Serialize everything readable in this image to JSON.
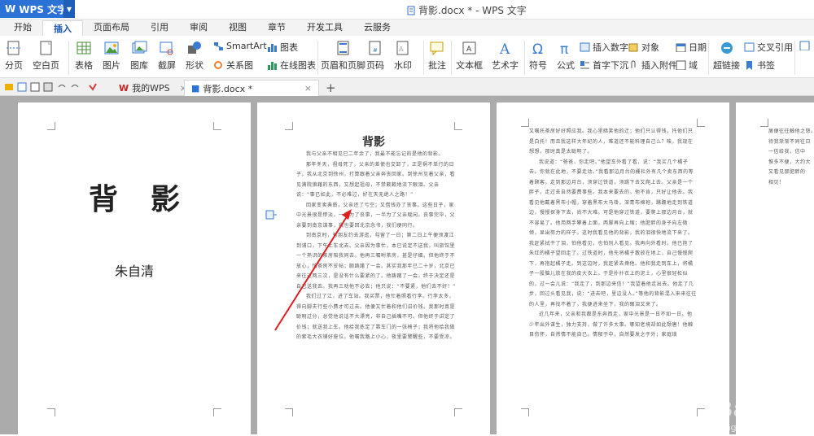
{
  "app": {
    "name": "WPS 文字",
    "window_title": "背影.docx * - WPS 文字"
  },
  "menus": [
    "开始",
    "插入",
    "页面布局",
    "引用",
    "审阅",
    "视图",
    "章节",
    "开发工具",
    "云服务"
  ],
  "active_menu": "插入",
  "ribbon": {
    "page_break": "分页",
    "blank_page": "空白页",
    "table": "表格",
    "picture": "图片",
    "gallery": "图库",
    "screenshot": "截屏",
    "shapes": "形状",
    "smartart": "SmartArt",
    "chart": "图表",
    "relation_chart": "关系图",
    "online_chart": "在线图表",
    "header_footer": "页眉和页脚",
    "page_number": "页码",
    "watermark": "水印",
    "comment": "批注",
    "textbox": "文本框",
    "wordart": "艺术字",
    "symbol": "符号",
    "formula": "公式",
    "insert_number": "插入数字",
    "object": "对象",
    "date": "日期",
    "dropcap": "首字下沉",
    "attachment": "插入附件",
    "field": "域",
    "hyperlink": "超链接",
    "crossref": "交叉引用",
    "bookmark": "书签"
  },
  "tabs": {
    "home": "我的WPS",
    "doc": "背影.docx *"
  },
  "cover": {
    "title": "背影",
    "author": "朱自清"
  },
  "page2": {
    "title": "背影",
    "paragraphs": [
      "我与父亲不相见已二年余了，我最不能忘记的是他的背影。",
      "那年冬天，祖母死了，父亲的差使也交卸了，正是祸不单行的日子。我从北京到徐州，打算跟着父亲奔丧回家。到徐州见着父亲，看见满院狼藉的东西，又想起祖母，不禁簌簌地流下眼泪。父亲说：“事已如此，不必难过，好在天无绝人之路！”",
      "回家变卖典质，父亲还了亏空；又借钱办了丧事。这些日子，家中光景很是惨淡，一半为了丧事，一半为了父亲赋闲。丧事完毕，父亲要到南京谋事，我也要回北京念书，我们便同行。",
      "到南京时，有朋友约去游逛，勾留了一日；第二日上午便须渡江到浦口，下午上车北去。父亲因为事忙，本已说定不送我，叫旅馆里一个熟识的茶房陪我同去。他再三嘱咐茶房，甚是仔细。但他终于不放心，怕茶房不妥帖；颇踌躇了一会。其实我那年已二十岁，北京已来往过两三次，是没有什么要紧的了。他踌躇了一会，终于决定还是自己送我去。我再三劝他不必去；他只说：“不要紧，他们去不好！”",
      "我们过了江，进了车站。我买票，他忙着照看行李。行李太多，得向脚夫行些小费才可过去。他便又忙着和他们讲价钱。我那时真是聪明过分，总觉他说话不大漂亮，非自己插嘴不可。但他终于讲定了价钱；就送我上车。他给我拣定了靠车门的一张椅子；我将他给我做的紫毛大衣铺好座位。他嘱我路上小心，夜里要警醒些，不要受凉。"
    ]
  },
  "page3": {
    "paragraphs": [
      "又嘱托茶房好好照应我。我心里暗笑他的迂；他们只认得钱，托他们只是白托！而且我这样大年纪的人，难道还不能料理自己么？唉，我现在想想，那时真是太聪明了。",
      "我说道：“爸爸，你走吧。”他望车外看了看，说：“我买几个橘子去。你就在此地，不要走动。”我看那边月台的栅栏外有几个卖东西的等着顾客。走到那边月台，须穿过铁道，须跳下去又爬上去。父亲是一个胖子，走过去自然要费事些。我本来要去的，他不肯，只好让他去。我看见他戴着黑布小帽，穿着黑布大马褂，深青布棉袍，蹒跚地走到铁道边，慢慢探身下去，尚不大难。可是他穿过铁道，要爬上那边月台，就不容易了。他用两手攀着上面，两脚再向上缩；他肥胖的身子向左微倾，显出努力的样子。这时我看见他的背影，我的泪很快地流下来了。我赶紧拭干了泪，怕他看见，也怕别人看见。我再向外看时，他已抱了朱红的橘子望回走了。过铁道时，他先将橘子散放在地上，自己慢慢爬下，再抱起橘子走。到这边时，我赶紧去搀他。他和我走到车上，将橘子一股脑儿放在我的皮大衣上。于是扑扑衣上的泥土，心里很轻松似的，过一会儿说：“我走了，到那边来信！”我望着他走出去。他走了几步，回过头看见我，说：“进去吧，里边没人。”等他的背影混入来来往往的人里，再找不着了，我便进来坐下，我的眼泪又来了。",
      "近几年来，父亲和我都是东奔西走，家中光景是一日不如一日。他少年出外谋生，独力支持，做了许多大事。哪知老境却如此颓唐！他触目伤怀，自然情不能自已。情郁于中，自然要发之于外；家庭琐"
    ]
  },
  "page4": {
    "lines": [
      "屑便往往触他之怒。",
      "待我渐渐不同往日",
      "一信给我，信中",
      "惟多不便，大约大",
      "又看见那肥胖的",
      "相见！"
    ]
  },
  "watermark": {
    "text": "Bai 经验",
    "sub": "jingyan.baidu.com"
  }
}
